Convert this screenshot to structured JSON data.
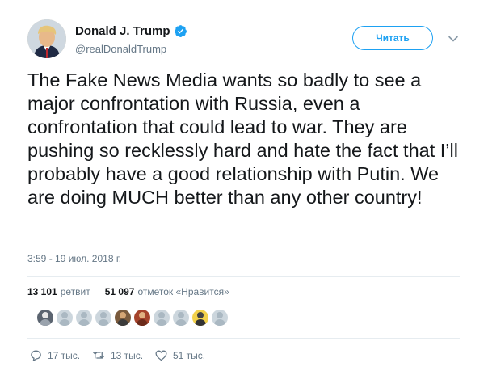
{
  "author": {
    "display_name": "Donald J. Trump",
    "handle": "@realDonaldTrump",
    "verified": true,
    "avatar_icon": "user-photo"
  },
  "follow_button_label": "Читать",
  "tweet": {
    "text": "The Fake News Media wants so badly to see a major confrontation with Russia, even a confrontation that could lead to war. They are pushing so recklessly hard and hate the fact that I’ll probably have a good relationship with Putin. We are doing MUCH better than any other country!",
    "timestamp": "3:59 - 19 июл. 2018 г."
  },
  "stats": {
    "retweets_count": "13 101",
    "retweets_label": "ретвит",
    "likes_count": "51 097",
    "likes_label": "отметок «Нравится»"
  },
  "likers": [
    "liker-avatar-1",
    "liker-avatar-2",
    "liker-avatar-3",
    "liker-avatar-4",
    "liker-avatar-5",
    "liker-avatar-6",
    "liker-avatar-7",
    "liker-avatar-8",
    "liker-avatar-9",
    "liker-avatar-10"
  ],
  "actions": {
    "reply_count": "17 тыс.",
    "retweet_count": "13 тыс.",
    "like_count": "51 тыс."
  },
  "colors": {
    "accent": "#1da1f2",
    "text": "#14171a",
    "secondary_text": "#657786",
    "divider": "#e6ecf0"
  }
}
